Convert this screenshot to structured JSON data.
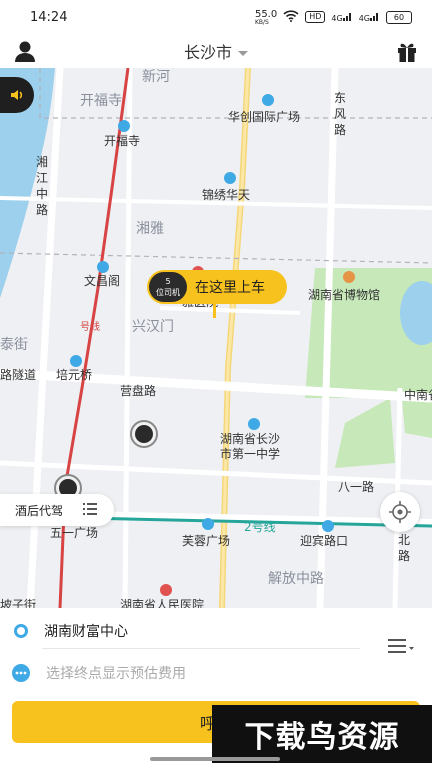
{
  "status_bar": {
    "time": "14:24",
    "net_speed": "55.0",
    "net_unit": "KB/S",
    "hd": "HD",
    "signal_1": "4G",
    "signal_2": "4G",
    "battery": "60"
  },
  "header": {
    "city": "长沙市"
  },
  "map": {
    "labels": {
      "xinhe": "新河",
      "kaifusi_area": "开福寺",
      "kaifusi_stop": "开福寺",
      "huachuang": "华创国际广场",
      "dongfeng": "东风路",
      "xiangjiang": "湘江中路",
      "jinxiu": "锦绣华天",
      "xiangya": "湘雅",
      "wenchangge": "文昌阁",
      "hospital": "中南大学湘雅医院",
      "museum": "湖南省博物馆",
      "line_no": "号线",
      "xinghanmen": "兴汉门",
      "taiji": "泰街",
      "tunnel": "路隧道",
      "peiyuan": "培元桥",
      "yingpan": "营盘路",
      "nanhu": "中南省",
      "school": "湖南省长沙市第一中学",
      "bayi": "八一路",
      "shaoshan": "韶山北路",
      "wuyi": "五一广场",
      "line2": "2号线",
      "furong": "芙蓉广场",
      "yingbin": "迎宾路口",
      "jiefang": "解放中路",
      "bozijie": "坡子街",
      "people_hosp": "湖南省人民医院"
    }
  },
  "pickup_marker": {
    "count": "5",
    "badge_text": "位司机",
    "label": "在这里上车"
  },
  "service_tab": {
    "label": "酒后代驾"
  },
  "trip": {
    "from": "湖南财富中心",
    "to_placeholder": "选择终点显示预估费用"
  },
  "call_button": {
    "label": "呼叫"
  },
  "watermark": {
    "text": "下载鸟资源"
  },
  "colors": {
    "accent": "#f7c21e",
    "location": "#3fa9e6",
    "metro": "#26a69a",
    "line1": "#d84343"
  }
}
